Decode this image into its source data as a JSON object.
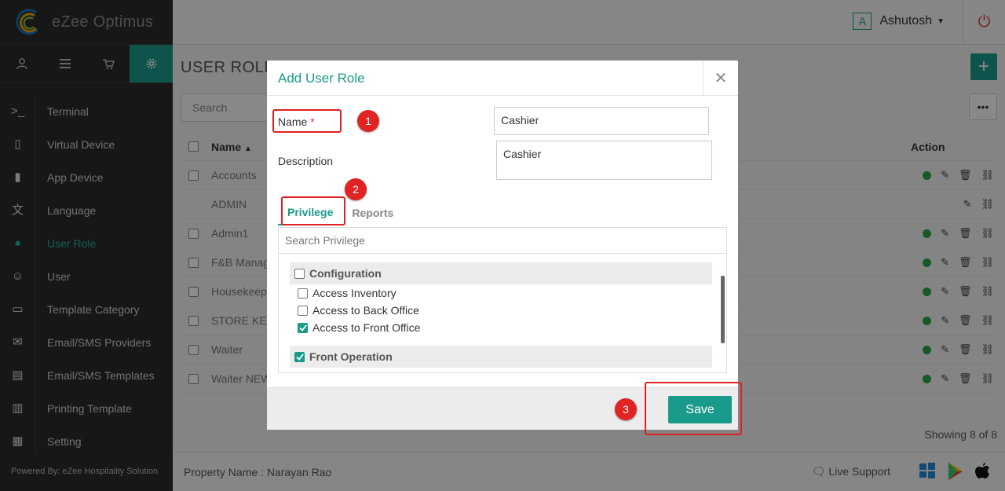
{
  "app": {
    "logo_text": "eZee Optimus",
    "powered_by": "Powered By: eZee Hospitality Solution"
  },
  "header": {
    "user_initial": "A",
    "user_name": "Ashutosh"
  },
  "sidebar": {
    "items": [
      {
        "label": "Terminal",
        "icon": "terminal-icon"
      },
      {
        "label": "Virtual Device",
        "icon": "tablet-icon"
      },
      {
        "label": "App Device",
        "icon": "mobile-icon"
      },
      {
        "label": "Language",
        "icon": "language-icon"
      },
      {
        "label": "User Role",
        "icon": "user-role-icon"
      },
      {
        "label": "User",
        "icon": "user-icon"
      },
      {
        "label": "Template Category",
        "icon": "inbox-icon"
      },
      {
        "label": "Email/SMS Providers",
        "icon": "envelope-icon"
      },
      {
        "label": "Email/SMS Templates",
        "icon": "template-icon"
      },
      {
        "label": "Printing Template",
        "icon": "document-icon"
      },
      {
        "label": "Setting",
        "icon": "settings-icon"
      }
    ]
  },
  "main": {
    "title": "USER ROLE",
    "search_placeholder": "Search",
    "col_name": "Name",
    "col_action": "Action",
    "rows": [
      "Accounts",
      "ADMIN",
      "Admin1",
      "F&B Manag",
      "Housekeep",
      "STORE KE",
      "Waiter",
      "Waiter NEW"
    ],
    "showing": "Showing 8 of 8"
  },
  "footer": {
    "property": "Property Name : Narayan Rao",
    "live_support": "Live Support"
  },
  "modal": {
    "title": "Add User Role",
    "name_label": "Name",
    "name_required": "*",
    "name_value": "Cashier",
    "description_label": "Description",
    "description_value": "Cashier",
    "tabs": [
      "Privilege",
      "Reports"
    ],
    "search_privilege_placeholder": "Search Privilege",
    "groups": [
      {
        "label": "Configuration",
        "checked": false
      },
      {
        "label": "Front Operation",
        "checked": true
      }
    ],
    "privileges": [
      {
        "label": "Access Inventory",
        "checked": false
      },
      {
        "label": "Access to Back Office",
        "checked": false
      },
      {
        "label": "Access to Front Office",
        "checked": true
      }
    ],
    "save_label": "Save"
  },
  "annotations": [
    "1",
    "2",
    "3"
  ],
  "colors": {
    "accent": "#1a9a8a",
    "annotation": "#e02020"
  }
}
